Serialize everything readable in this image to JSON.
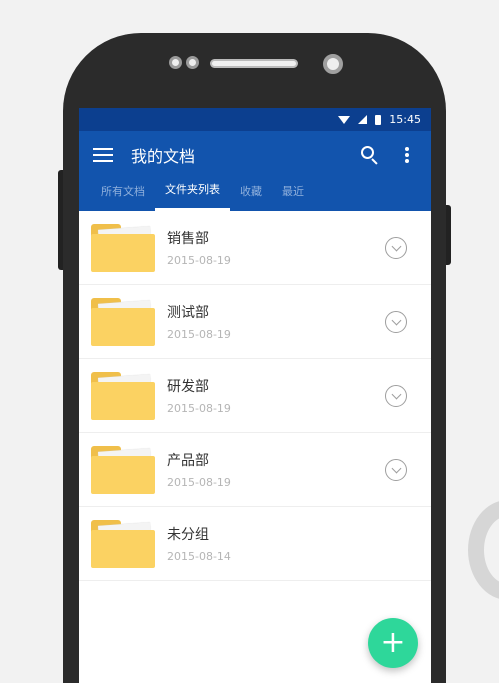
{
  "status_bar": {
    "time": "15:45"
  },
  "toolbar": {
    "title": "我的文档"
  },
  "tabs": [
    {
      "label": "所有文档",
      "active": false
    },
    {
      "label": "文件夹列表",
      "active": true
    },
    {
      "label": "收藏",
      "active": false
    },
    {
      "label": "最近",
      "active": false
    }
  ],
  "folders": [
    {
      "name": "销售部",
      "date": "2015-08-19",
      "has_menu": true
    },
    {
      "name": "测试部",
      "date": "2015-08-19",
      "has_menu": true
    },
    {
      "name": "研发部",
      "date": "2015-08-19",
      "has_menu": true
    },
    {
      "name": "产品部",
      "date": "2015-08-19",
      "has_menu": true
    },
    {
      "name": "未分组",
      "date": "2015-08-14",
      "has_menu": false
    }
  ],
  "fab": {
    "label": "+"
  },
  "colors": {
    "status_bar": "#0c3f8f",
    "app_bar": "#1254ad",
    "fab": "#2ed79a",
    "folder": "#fbd262"
  },
  "icons": {
    "menu": "menu-icon",
    "search": "search-icon",
    "more": "more-vert-icon",
    "wifi": "wifi-icon",
    "signal": "signal-icon",
    "battery": "battery-icon",
    "chevron": "chevron-down-circle-icon",
    "folder": "folder-icon"
  }
}
